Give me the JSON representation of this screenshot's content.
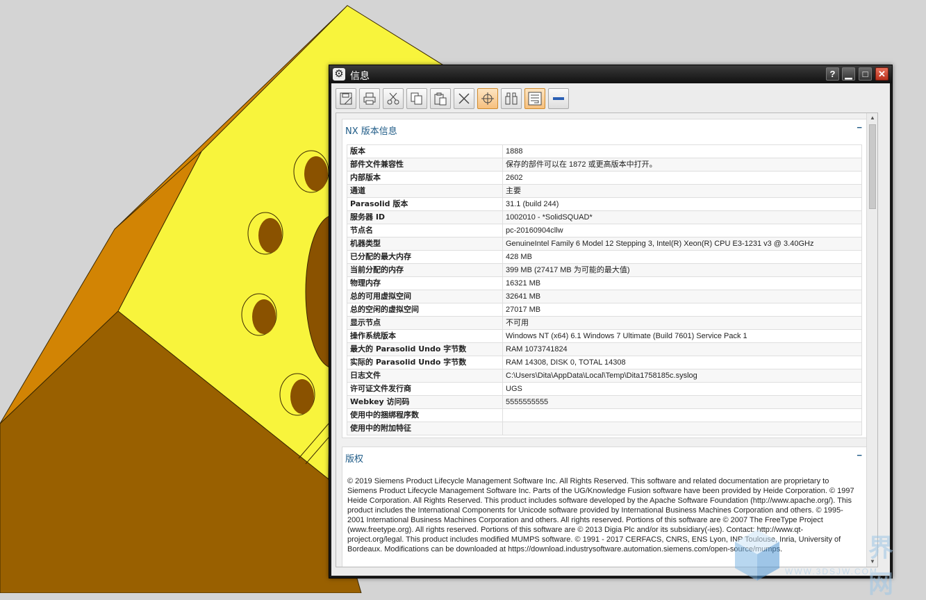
{
  "dialog": {
    "title": "信息",
    "title_icon": "gear-icon",
    "help_label": "?",
    "min_label": "▁",
    "max_label": "□",
    "close_label": "✕"
  },
  "toolbar": {
    "buttons": [
      {
        "name": "save-icon"
      },
      {
        "name": "print-icon"
      },
      {
        "name": "cut-icon"
      },
      {
        "name": "copy-icon"
      },
      {
        "name": "paste-icon"
      },
      {
        "name": "delete-icon"
      },
      {
        "name": "crosshair-icon",
        "active": true
      },
      {
        "name": "find-icon"
      },
      {
        "name": "wrap-icon",
        "active": true
      },
      {
        "name": "minus-icon"
      }
    ]
  },
  "info_panel": {
    "title": "NX 版本信息",
    "collapse": "−",
    "rows": [
      {
        "key": "版本",
        "value": "1888"
      },
      {
        "key": "部件文件兼容性",
        "value": "保存的部件可以在 1872 或更高版本中打开。"
      },
      {
        "key": "内部版本",
        "value": "2602"
      },
      {
        "key": "通道",
        "value": "主要"
      },
      {
        "key": "Parasolid 版本",
        "value": "31.1 (build 244)"
      },
      {
        "key": "服务器 ID",
        "value": "1002010 - *SolidSQUAD*"
      },
      {
        "key": "节点名",
        "value": "pc-20160904cllw"
      },
      {
        "key": "机器类型",
        "value": "GenuineIntel Family 6 Model 12 Stepping 3, Intel(R) Xeon(R) CPU E3-1231 v3 @ 3.40GHz"
      },
      {
        "key": "已分配的最大内存",
        "value": "428 MB"
      },
      {
        "key": "当前分配的内存",
        "value": "399 MB (27417 MB 为可能的最大值)"
      },
      {
        "key": "物理内存",
        "value": "16321 MB"
      },
      {
        "key": "总的可用虚拟空间",
        "value": "32641 MB"
      },
      {
        "key": "总的空闲的虚拟空间",
        "value": "27017 MB"
      },
      {
        "key": "显示节点",
        "value": "不可用"
      },
      {
        "key": "操作系统版本",
        "value": "Windows NT (x64) 6.1 Windows 7 Ultimate (Build 7601) Service Pack 1"
      },
      {
        "key": "最大的 Parasolid Undo 字节数",
        "value": "RAM 1073741824"
      },
      {
        "key": "实际的 Parasolid Undo 字节数",
        "value": "RAM 14308, DISK 0, TOTAL 14308"
      },
      {
        "key": "日志文件",
        "value": "C:\\Users\\Dita\\AppData\\Local\\Temp\\Dita1758185c.syslog"
      },
      {
        "key": "许可证文件发行商",
        "value": "UGS"
      },
      {
        "key": "Webkey 访问码",
        "value": "5555555555"
      },
      {
        "key": "使用中的捆绑程序数",
        "value": ""
      },
      {
        "key": "使用中的附加特征",
        "value": ""
      }
    ]
  },
  "copyright_panel": {
    "title": "版权",
    "collapse": "−",
    "text": "© 2019 Siemens Product Lifecycle Management Software Inc. All Rights Reserved. This software and related documentation are proprietary to Siemens Product Lifecycle Management Software Inc. Parts of the UG/Knowledge Fusion software have been provided by Heide Corporation. © 1997 Heide Corporation. All Rights Reserved. This product includes software developed by the Apache Software Foundation (http://www.apache.org/). This product includes the International Components for Unicode software provided by International Business Machines Corporation and others. © 1995-2001 International Business Machines Corporation and others. All rights reserved. Portions of this software are © 2007 The FreeType Project (www.freetype.org). All rights reserved. Portions of this software are © 2013 Digia Plc and/or its subsidiary(-ies). Contact: http://www.qt-project.org/legal. This product includes modified MUMPS software. © 1991 - 2017 CERFACS, CNRS, ENS Lyon, INP Toulouse, Inria, University of Bordeaux. Modifications can be downloaded at https://download.industrysoftware.automation.siemens.com/open-source/mumps."
  },
  "watermark": {
    "text": "界网",
    "url": "WWW.3DSJW.COM"
  },
  "colors": {
    "model_face_light": "#f8f43c",
    "model_face_orange": "#d28404",
    "model_face_brown": "#996000",
    "accent_blue": "#1d5a86"
  }
}
